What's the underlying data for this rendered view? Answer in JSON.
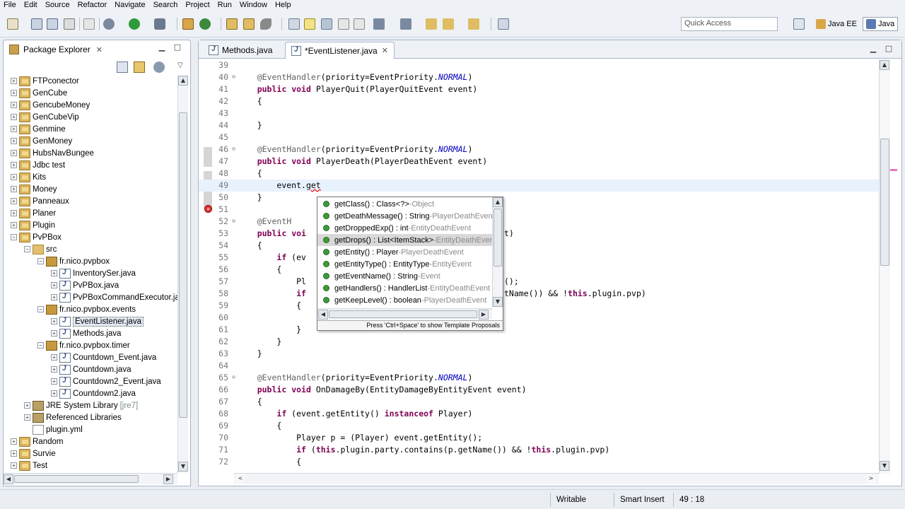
{
  "menu": [
    "File",
    "Edit",
    "Source",
    "Refactor",
    "Navigate",
    "Search",
    "Project",
    "Run",
    "Window",
    "Help"
  ],
  "toolbar": {
    "quick_access_placeholder": "Quick Access",
    "perspectives": [
      {
        "label": "Java EE",
        "icon": "java-ee-perspective-icon"
      },
      {
        "label": "Java",
        "icon": "java-perspective-icon"
      }
    ]
  },
  "package_explorer": {
    "title": "Package Explorer",
    "tree": [
      {
        "label": "FTPconector",
        "type": "project",
        "depth": 0,
        "expanded": false
      },
      {
        "label": "GenCube",
        "type": "project",
        "depth": 0,
        "expanded": false
      },
      {
        "label": "GencubeMoney",
        "type": "project",
        "depth": 0,
        "expanded": false
      },
      {
        "label": "GenCubeVip",
        "type": "project",
        "depth": 0,
        "expanded": false
      },
      {
        "label": "Genmine",
        "type": "project",
        "depth": 0,
        "expanded": false
      },
      {
        "label": "GenMoney",
        "type": "project",
        "depth": 0,
        "expanded": false
      },
      {
        "label": "HubsNavBungee",
        "type": "project",
        "depth": 0,
        "expanded": false
      },
      {
        "label": "Jdbc test",
        "type": "project",
        "depth": 0,
        "expanded": false
      },
      {
        "label": "Kits",
        "type": "project",
        "depth": 0,
        "expanded": false
      },
      {
        "label": "Money",
        "type": "project",
        "depth": 0,
        "expanded": false
      },
      {
        "label": "Panneaux",
        "type": "project",
        "depth": 0,
        "expanded": false
      },
      {
        "label": "Planer",
        "type": "project",
        "depth": 0,
        "expanded": false
      },
      {
        "label": "Plugin",
        "type": "project",
        "depth": 0,
        "expanded": false
      },
      {
        "label": "PvPBox",
        "type": "project",
        "depth": 0,
        "expanded": true
      },
      {
        "label": "src",
        "type": "srcfolder",
        "depth": 1,
        "expanded": true
      },
      {
        "label": "fr.nico.pvpbox",
        "type": "package",
        "depth": 2,
        "expanded": true
      },
      {
        "label": "InventorySer.java",
        "type": "jfile",
        "depth": 3,
        "expanded": false
      },
      {
        "label": "PvPBox.java",
        "type": "jfile",
        "depth": 3,
        "expanded": false
      },
      {
        "label": "PvPBoxCommandExecutor.java",
        "type": "jfile",
        "depth": 3,
        "expanded": false
      },
      {
        "label": "fr.nico.pvpbox.events",
        "type": "package",
        "depth": 2,
        "expanded": true
      },
      {
        "label": "EventListener.java",
        "type": "jfile",
        "depth": 3,
        "expanded": false,
        "selected": true
      },
      {
        "label": "Methods.java",
        "type": "jfile",
        "depth": 3,
        "expanded": false
      },
      {
        "label": "fr.nico.pvpbox.timer",
        "type": "package",
        "depth": 2,
        "expanded": true
      },
      {
        "label": "Countdown_Event.java",
        "type": "jfile",
        "depth": 3,
        "expanded": false
      },
      {
        "label": "Countdown.java",
        "type": "jfile",
        "depth": 3,
        "expanded": false
      },
      {
        "label": "Countdown2_Event.java",
        "type": "jfile",
        "depth": 3,
        "expanded": false
      },
      {
        "label": "Countdown2.java",
        "type": "jfile",
        "depth": 3,
        "expanded": false
      },
      {
        "label": "JRE System Library",
        "decoration": "[jre7]",
        "type": "lib",
        "depth": 1,
        "expanded": false
      },
      {
        "label": "Referenced Libraries",
        "type": "lib",
        "depth": 1,
        "expanded": false
      },
      {
        "label": "plugin.yml",
        "type": "yml",
        "depth": 1,
        "leaf": true
      },
      {
        "label": "Random",
        "type": "project",
        "depth": 0,
        "expanded": false
      },
      {
        "label": "Survie",
        "type": "project",
        "depth": 0,
        "expanded": false
      },
      {
        "label": "Test",
        "type": "project",
        "depth": 0,
        "expanded": false
      }
    ]
  },
  "editor": {
    "tabs": [
      {
        "label": "Methods.java",
        "active": false
      },
      {
        "label": "*EventListener.java",
        "active": true
      }
    ],
    "current_line": 49,
    "error_line": 49,
    "lines": [
      {
        "n": "39",
        "tokens": [
          {
            "t": ""
          }
        ]
      },
      {
        "n": "40",
        "fold": true,
        "tokens": [
          {
            "t": "    "
          },
          {
            "t": "@EventHandler",
            "c": "an"
          },
          {
            "t": "(priority=EventPriority."
          },
          {
            "t": "NORMAL",
            "c": "it"
          },
          {
            "t": ")"
          }
        ]
      },
      {
        "n": "41",
        "tokens": [
          {
            "t": "    "
          },
          {
            "t": "public",
            "c": "kw"
          },
          {
            "t": " "
          },
          {
            "t": "void",
            "c": "kw"
          },
          {
            "t": " PlayerQuit(PlayerQuitEvent event)"
          }
        ]
      },
      {
        "n": "42",
        "tokens": [
          {
            "t": "    {"
          }
        ]
      },
      {
        "n": "43",
        "tokens": [
          {
            "t": ""
          }
        ]
      },
      {
        "n": "44",
        "tokens": [
          {
            "t": "    }"
          }
        ]
      },
      {
        "n": "45",
        "tokens": [
          {
            "t": ""
          }
        ]
      },
      {
        "n": "46",
        "fold": true,
        "tokens": [
          {
            "t": "    "
          },
          {
            "t": "@EventHandler",
            "c": "an"
          },
          {
            "t": "(priority=EventPriority."
          },
          {
            "t": "NORMAL",
            "c": "it"
          },
          {
            "t": ")"
          }
        ]
      },
      {
        "n": "47",
        "tokens": [
          {
            "t": "    "
          },
          {
            "t": "public",
            "c": "kw"
          },
          {
            "t": " "
          },
          {
            "t": "void",
            "c": "kw"
          },
          {
            "t": " PlayerDeath(PlayerDeathEvent event)"
          }
        ]
      },
      {
        "n": "48",
        "tokens": [
          {
            "t": "    {"
          }
        ]
      },
      {
        "n": "49",
        "tokens": [
          {
            "t": "        event."
          },
          {
            "t": "get",
            "c": "err"
          }
        ]
      },
      {
        "n": "50",
        "tokens": [
          {
            "t": "    }"
          }
        ]
      },
      {
        "n": "51",
        "tokens": [
          {
            "t": ""
          }
        ]
      },
      {
        "n": "52",
        "fold": true,
        "tokens": [
          {
            "t": "    "
          },
          {
            "t": "@EventH",
            "c": "an"
          }
        ]
      },
      {
        "n": "53",
        "tokens": [
          {
            "t": "    "
          },
          {
            "t": "public",
            "c": "kw"
          },
          {
            "t": " "
          },
          {
            "t": "voi",
            "c": "kw"
          }
        ]
      },
      {
        "n": "54",
        "tokens": [
          {
            "t": "    {"
          }
        ]
      },
      {
        "n": "55",
        "tokens": [
          {
            "t": "        "
          },
          {
            "t": "if",
            "c": "kw"
          },
          {
            "t": " (ev"
          }
        ]
      },
      {
        "n": "56",
        "tokens": [
          {
            "t": "        {"
          }
        ]
      },
      {
        "n": "57",
        "tokens": [
          {
            "t": "            Pl"
          }
        ]
      },
      {
        "n": "58",
        "tokens": [
          {
            "t": "            "
          },
          {
            "t": "if",
            "c": "kw"
          }
        ]
      },
      {
        "n": "59",
        "tokens": [
          {
            "t": "            {"
          }
        ]
      },
      {
        "n": "60",
        "tokens": [
          {
            "t": ""
          }
        ]
      },
      {
        "n": "61",
        "tokens": [
          {
            "t": "            }"
          }
        ]
      },
      {
        "n": "62",
        "tokens": [
          {
            "t": "        }"
          }
        ]
      },
      {
        "n": "63",
        "tokens": [
          {
            "t": "    }"
          }
        ]
      },
      {
        "n": "64",
        "tokens": [
          {
            "t": ""
          }
        ]
      },
      {
        "n": "65",
        "fold": true,
        "tokens": [
          {
            "t": "    "
          },
          {
            "t": "@EventHandler",
            "c": "an"
          },
          {
            "t": "(priority=EventPriority."
          },
          {
            "t": "NORMAL",
            "c": "it"
          },
          {
            "t": ")"
          }
        ]
      },
      {
        "n": "66",
        "tokens": [
          {
            "t": "    "
          },
          {
            "t": "public",
            "c": "kw"
          },
          {
            "t": " "
          },
          {
            "t": "void",
            "c": "kw"
          },
          {
            "t": " OnDamageBy(EntityDamageByEntityEvent event)"
          }
        ]
      },
      {
        "n": "67",
        "tokens": [
          {
            "t": "    {"
          }
        ]
      },
      {
        "n": "68",
        "tokens": [
          {
            "t": "        "
          },
          {
            "t": "if",
            "c": "kw"
          },
          {
            "t": " (event.getEntity() "
          },
          {
            "t": "instanceof",
            "c": "kw"
          },
          {
            "t": " Player)"
          }
        ]
      },
      {
        "n": "69",
        "tokens": [
          {
            "t": "        {"
          }
        ]
      },
      {
        "n": "70",
        "tokens": [
          {
            "t": "            Player p = (Player) event.getEntity();"
          }
        ]
      },
      {
        "n": "71",
        "tokens": [
          {
            "t": "            "
          },
          {
            "t": "if",
            "c": "kw"
          },
          {
            "t": " ("
          },
          {
            "t": "this",
            "c": "kw"
          },
          {
            "t": ".plugin.party.contains(p.getName()) && !"
          },
          {
            "t": "this",
            "c": "kw"
          },
          {
            "t": ".plugin.pvp)"
          }
        ]
      },
      {
        "n": "72",
        "tokens": [
          {
            "t": "            {"
          }
        ]
      }
    ],
    "overflow_fragments": [
      {
        "line": "53",
        "text": "t)"
      },
      {
        "line": "57",
        "text": "();"
      },
      {
        "line": "58",
        "text": "tName()) && !",
        "kw_after": "this",
        "rest": ".plugin.pvp)"
      }
    ]
  },
  "content_assist": {
    "proposals": [
      {
        "name": "getClass() : Class<?>",
        "owner": "Object"
      },
      {
        "name": "getDeathMessage() : String",
        "owner": "PlayerDeathEvent"
      },
      {
        "name": "getDroppedExp() : int",
        "owner": "EntityDeathEvent"
      },
      {
        "name": "getDrops() : List<ItemStack>",
        "owner": "EntityDeathEvent",
        "selected": true
      },
      {
        "name": "getEntity() : Player",
        "owner": "PlayerDeathEvent"
      },
      {
        "name": "getEntityType() : EntityType",
        "owner": "EntityEvent"
      },
      {
        "name": "getEventName() : String",
        "owner": "Event"
      },
      {
        "name": "getHandlers() : HandlerList",
        "owner": "EntityDeathEvent"
      },
      {
        "name": "getKeepLevel() : boolean",
        "owner": "PlayerDeathEvent"
      }
    ],
    "hint": "Press 'Ctrl+Space' to show Template Proposals"
  },
  "status": {
    "writable": "Writable",
    "insert_mode": "Smart Insert",
    "position": "49 : 18"
  }
}
